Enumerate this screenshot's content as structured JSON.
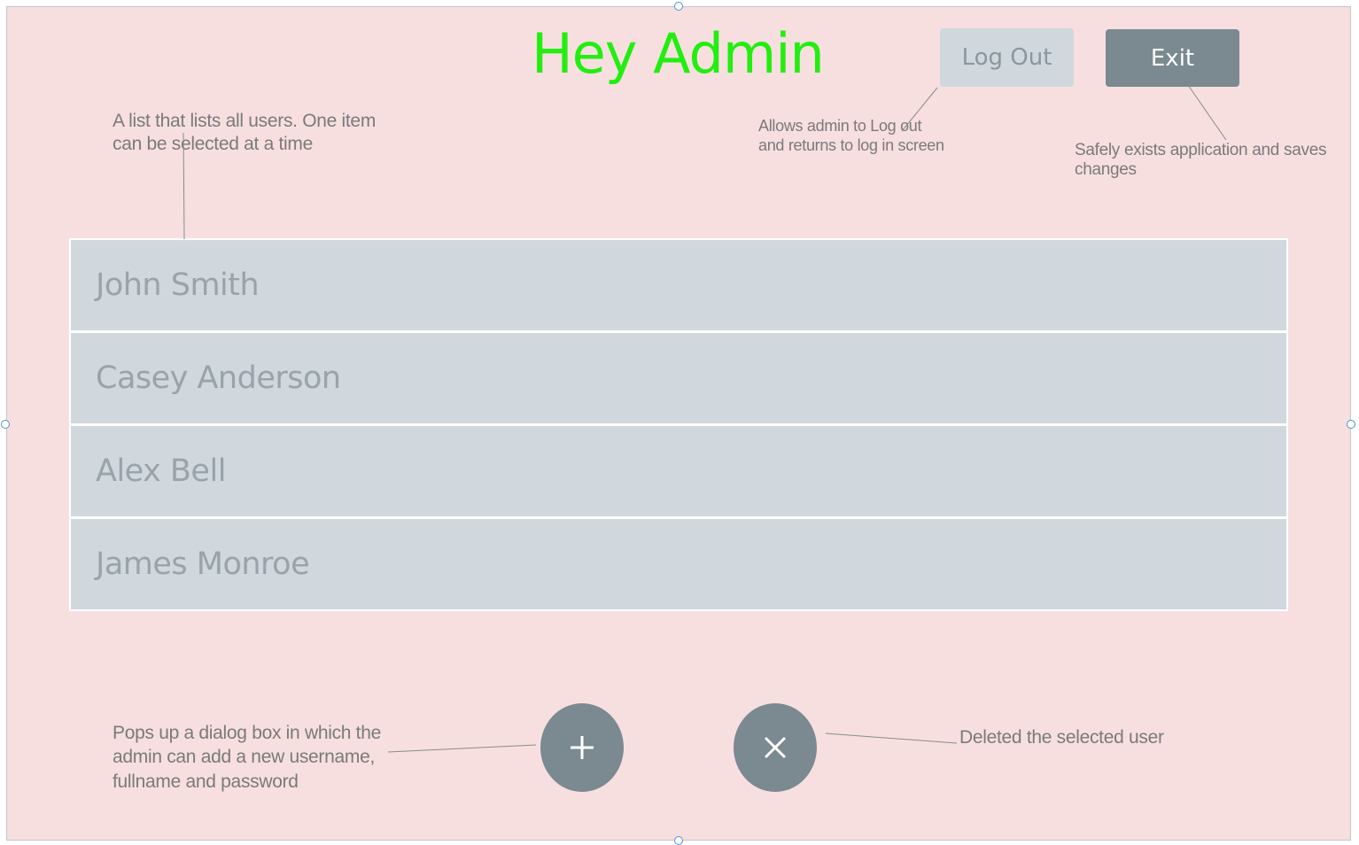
{
  "header": {
    "title": "Hey Admin",
    "logout_label": "Log Out",
    "exit_label": "Exit"
  },
  "annotations": {
    "list_note": [
      "A list that lists all users. One item",
      "can be selected at a time"
    ],
    "logout_note": [
      "Allows admin to Log out",
      "and returns to log in screen"
    ],
    "exit_note": [
      "Safely exists application and saves",
      "changes"
    ],
    "add_note": [
      "Pops up a dialog box in which the",
      "admin can add a new username,",
      "fullname and password"
    ],
    "delete_note": "Deleted the selected user"
  },
  "users": [
    "John Smith",
    "Casey Anderson",
    "Alex Bell",
    "James Monroe"
  ],
  "fab": {
    "add_icon": "plus-icon",
    "delete_icon": "close-icon"
  },
  "colors": {
    "background": "#f7dfe0",
    "title": "#22ee0f",
    "list_item": "#d0d8de",
    "list_text": "#99a3a9",
    "dark_button": "#7b8990",
    "light_button": "#d0d8de",
    "note_text": "#7a7a7a"
  }
}
